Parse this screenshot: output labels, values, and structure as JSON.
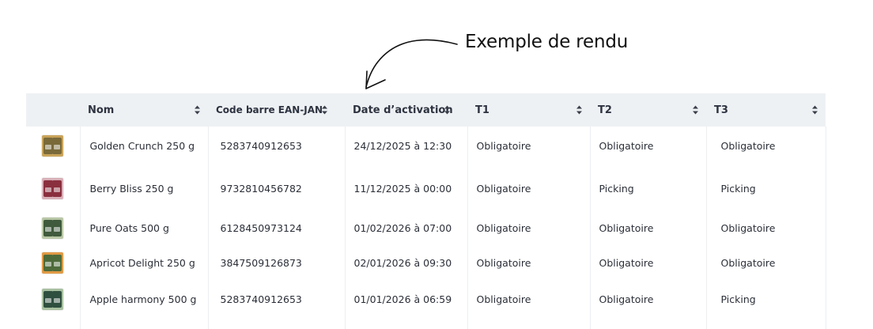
{
  "annotation": {
    "label": "Exemple de rendu"
  },
  "table": {
    "headers": {
      "image": "",
      "name": "Nom",
      "barcode": "Code barre EAN-JAN",
      "activation_date": "Date d’activation",
      "t1": "T1",
      "t2": "T2",
      "t3": "T3"
    },
    "rows": [
      {
        "thumb_color": "#7a6a3a",
        "thumb_accent": "#c9a45a",
        "name": "Golden Crunch 250 g",
        "barcode": "5283740912653",
        "activation_date": "24/12/2025 à 12:30",
        "t1": "Obligatoire",
        "t2": "Obligatoire",
        "t3": "Obligatoire"
      },
      {
        "thumb_color": "#8a2f3e",
        "thumb_accent": "#d8b0b8",
        "name": "Berry Bliss 250 g",
        "barcode": "9732810456782",
        "activation_date": "11/12/2025 à 00:00",
        "t1": "Obligatoire",
        "t2": "Picking",
        "t3": "Picking"
      },
      {
        "thumb_color": "#3f5a3c",
        "thumb_accent": "#b9c7a6",
        "name": "Pure Oats 500 g",
        "barcode": "6128450973124",
        "activation_date": "01/02/2026 à 07:00",
        "t1": "Obligatoire",
        "t2": "Obligatoire",
        "t3": "Obligatoire"
      },
      {
        "thumb_color": "#4d6b3a",
        "thumb_accent": "#e09a45",
        "name": "Apricot Delight 250 g",
        "barcode": "3847509126873",
        "activation_date": "02/01/2026 à 09:30",
        "t1": "Obligatoire",
        "t2": "Obligatoire",
        "t3": "Obligatoire"
      },
      {
        "thumb_color": "#2f4f3f",
        "thumb_accent": "#a8c0a0",
        "name": "Apple harmony 500 g",
        "barcode": "5283740912653",
        "activation_date": "01/01/2026 à 06:59",
        "t1": "Obligatoire",
        "t2": "Obligatoire",
        "t3": "Picking"
      }
    ]
  },
  "icons": {
    "sort": "sort-up-down-icon",
    "arrow": "curved-arrow-icon"
  }
}
